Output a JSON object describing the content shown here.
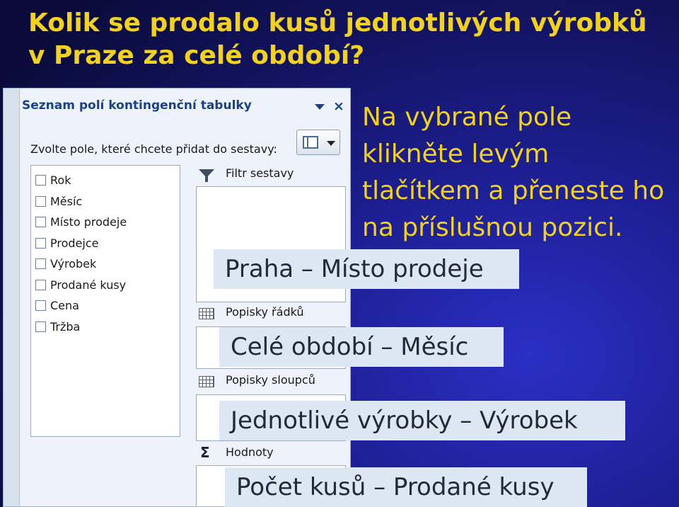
{
  "slide": {
    "title_line1": "Kolik se prodalo kusů jednotlivých výrobků",
    "title_line2": "v Praze za celé období?"
  },
  "callout": {
    "lines": [
      "Na vybrané pole",
      "klikněte levým",
      "tlačítkem a přeneste ho",
      "na příslušnou pozici."
    ]
  },
  "panel": {
    "header": "Seznam polí kontingenční tabulky",
    "prompt": "Zvolte pole, které chcete přidat do sestavy:",
    "fields": [
      "Rok",
      "Měsíc",
      "Místo prodeje",
      "Prodejce",
      "Výrobek",
      "Prodané kusy",
      "Cena",
      "Tržba"
    ],
    "areas": {
      "filter": "Filtr sestavy",
      "rows": "Popisky řádků",
      "columns": "Popisky sloupců",
      "values": "Hodnoty"
    },
    "icons": {
      "dropdown": "chevron-down-icon",
      "close": "close-icon",
      "layout": "field-layout-icon",
      "filter": "funnel-icon",
      "rows": "grid-icon",
      "columns": "grid-icon",
      "values": "sigma-icon"
    }
  },
  "tags": {
    "filter": "Praha – Místo prodeje",
    "columns": "Celé období – Měsíc",
    "rows": "Jednotlivé výrobky – Výrobek",
    "values": "Počet kusů – Prodané kusy"
  },
  "colors": {
    "title": "#f2d21c",
    "background": "#1d1f94",
    "panel_header": "#15428b",
    "tag_background": "#dde6f3"
  }
}
